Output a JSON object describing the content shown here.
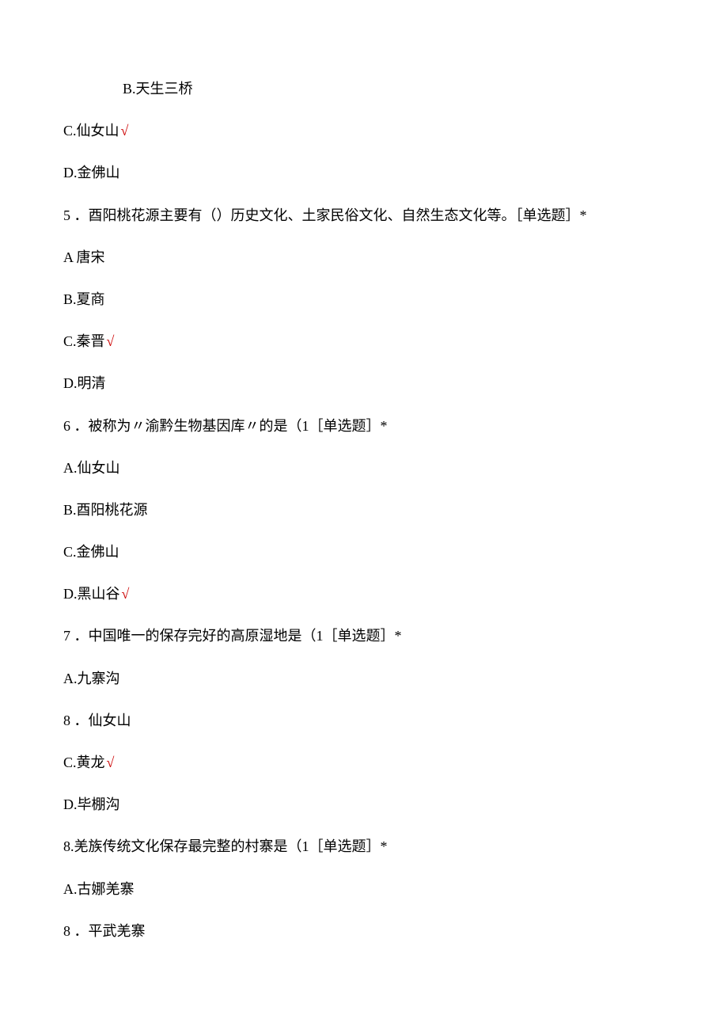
{
  "checkmark": "√",
  "q4": {
    "optB": "B.天生三桥",
    "optC": "C.仙女山",
    "optD": "D.金佛山"
  },
  "q5": {
    "stem": "5 ．酉阳桃花源主要有（）历史文化、土家民俗文化、自然生态文化等。［单选题］*",
    "optA": "A 唐宋",
    "optB": "B.夏商",
    "optC": "C.秦晋",
    "optD": "D.明清"
  },
  "q6": {
    "stem": "6 ．被称为〃渝黔生物基因库〃的是（1［单选题］*",
    "optA": "A.仙女山",
    "optB": "B.酉阳桃花源",
    "optC": "C.金佛山",
    "optD": "D.黑山谷"
  },
  "q7": {
    "stem": "7 ．中国唯一的保存完好的高原湿地是（1［单选题］*",
    "optA": "A.九寨沟",
    "optB": "8 ．仙女山",
    "optC": "C.黄龙",
    "optD": "D.毕棚沟"
  },
  "q8": {
    "stem": "8.羌族传统文化保存最完整的村寨是（1［单选题］*",
    "optA": "A.古娜羌寨",
    "optB": "8 ．平武羌寨"
  }
}
